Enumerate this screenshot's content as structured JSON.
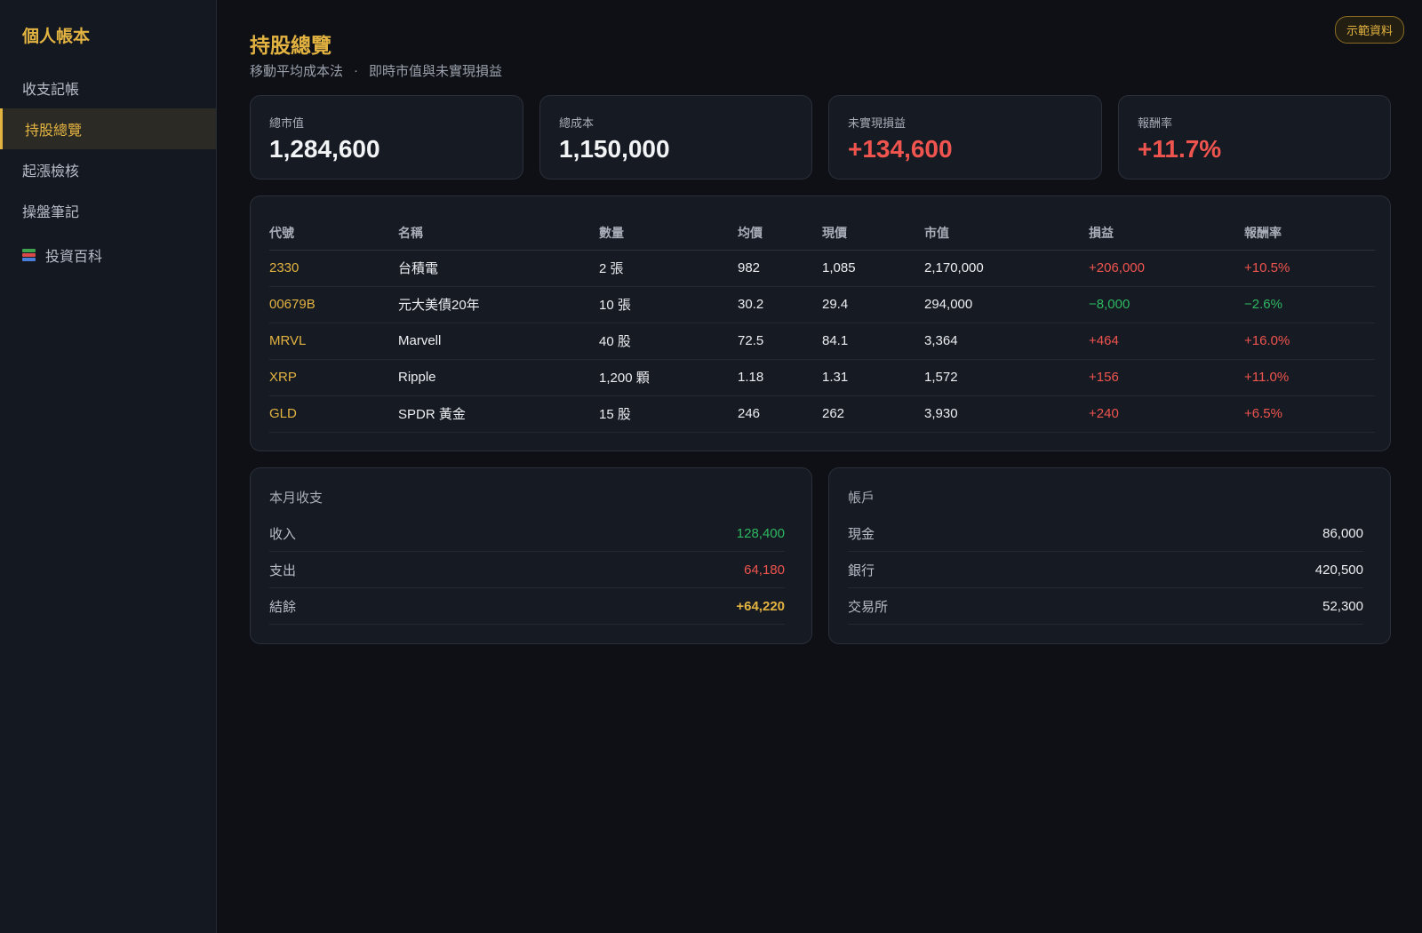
{
  "sidebar": {
    "brand": "個人帳本",
    "items": [
      {
        "label": "收支記帳"
      },
      {
        "label": "持股總覽"
      },
      {
        "label": "起漲檢核"
      },
      {
        "label": "操盤筆記"
      },
      {
        "label": "投資百科",
        "icon": "books-icon"
      }
    ]
  },
  "header": {
    "title": "持股總覽",
    "subtitle_method": "移動平均成本法",
    "subtitle_sep": "·",
    "subtitle_desc": "即時市值與未實現損益",
    "badge": "示範資料"
  },
  "stats": [
    {
      "label": "總市值",
      "value": "1,284,600"
    },
    {
      "label": "總成本",
      "value": "1,150,000"
    },
    {
      "label": "未實現損益",
      "value": "+134,600"
    },
    {
      "label": "報酬率",
      "value": "+11.7%"
    }
  ],
  "holdings": {
    "columns": [
      "代號",
      "名稱",
      "數量",
      "均價",
      "現價",
      "市值",
      "損益",
      "報酬率"
    ],
    "rows": [
      {
        "code": "2330",
        "name": "台積電",
        "qty": "2 張",
        "avg": "982",
        "price": "1,085",
        "value": "2,170,000",
        "pnl": "+206,000",
        "ret": "+10.5%"
      },
      {
        "code": "00679B",
        "name": "元大美債20年",
        "qty": "10 張",
        "avg": "30.2",
        "price": "29.4",
        "value": "294,000",
        "pnl": "−8,000",
        "ret": "−2.6%"
      },
      {
        "code": "MRVL",
        "name": "Marvell",
        "qty": "40 股",
        "avg": "72.5",
        "price": "84.1",
        "value": "3,364",
        "pnl": "+464",
        "ret": "+16.0%"
      },
      {
        "code": "XRP",
        "name": "Ripple",
        "qty": "1,200 顆",
        "avg": "1.18",
        "price": "1.31",
        "value": "1,572",
        "pnl": "+156",
        "ret": "+11.0%"
      },
      {
        "code": "GLD",
        "name": "SPDR 黃金",
        "qty": "15 股",
        "avg": "246",
        "price": "262",
        "value": "3,930",
        "pnl": "+240",
        "ret": "+6.5%"
      }
    ]
  },
  "monthly": {
    "title": "本月收支",
    "income_label": "收入",
    "income": "128,400",
    "expense_label": "支出",
    "expense": "64,180",
    "balance_label": "結餘",
    "balance": "+64,220"
  },
  "accounts": {
    "title": "帳戶",
    "items": [
      {
        "label": "現金",
        "value": "86,000"
      },
      {
        "label": "銀行",
        "value": "420,500"
      },
      {
        "label": "交易所",
        "value": "52,300"
      }
    ]
  },
  "colors": {
    "accent": "#e3b341",
    "gain": "#f0544f",
    "loss": "#2fb862"
  }
}
